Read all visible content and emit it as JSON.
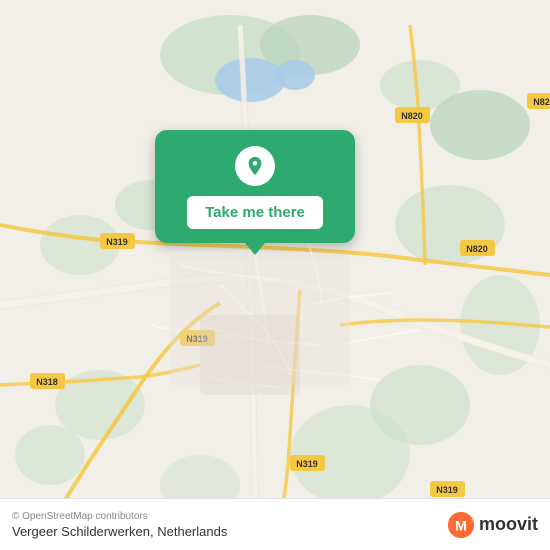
{
  "map": {
    "background_color": "#f2efe9",
    "attribution": "© OpenStreetMap contributors"
  },
  "popup": {
    "button_label": "Take me there",
    "background_color": "#2eaa6e"
  },
  "bottom_bar": {
    "location_name": "Vergeer Schilderwerken, Netherlands",
    "copyright": "© OpenStreetMap contributors",
    "moovit_text": "moovit"
  }
}
